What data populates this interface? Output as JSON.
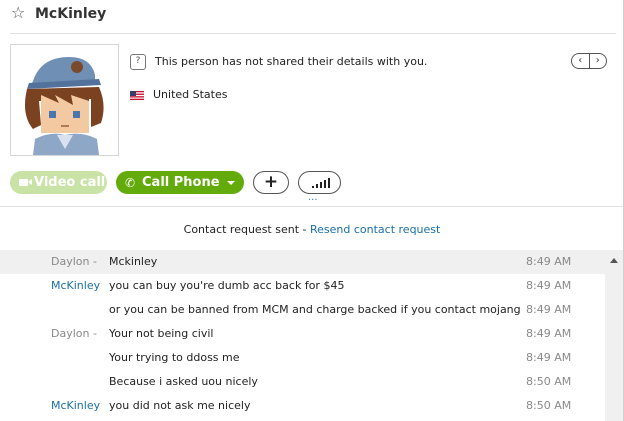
{
  "header": {
    "title": "McKinley",
    "star_icon": "star-icon"
  },
  "profile": {
    "details_note": "This person has not shared their details with you.",
    "country": "United States",
    "nav_prev": "‹",
    "nav_next": "›"
  },
  "actions": {
    "video_call_label": "Video call",
    "call_phone_label": "Call Phone",
    "add_label": "+",
    "more_dots": "···"
  },
  "contact_request": {
    "status": "Contact request sent",
    "separator": " - ",
    "resend_link": "Resend contact request"
  },
  "messages": [
    {
      "sender": "Daylon -",
      "text": "Mckinley",
      "time": "8:49 AM"
    },
    {
      "sender": "McKinley",
      "text": "you can buy you're dumb acc back for $45",
      "time": "8:49 AM"
    },
    {
      "sender": "",
      "text": "or you can be banned from MCM and charge backed if you contact mojang",
      "time": "8:49 AM"
    },
    {
      "sender": "Daylon -",
      "text": "Your not being civil",
      "time": "8:49 AM"
    },
    {
      "sender": "",
      "text": "Your trying to ddoss me",
      "time": "8:49 AM"
    },
    {
      "sender": "",
      "text": "Because i asked uou nicely",
      "time": "8:50 AM"
    },
    {
      "sender": "McKinley",
      "text": "you did not ask me nicely",
      "time": "8:50 AM"
    }
  ],
  "colors": {
    "accent_green": "#62ab0a",
    "disabled_green": "#c9e3a6",
    "link_blue": "#1a6ea8"
  }
}
